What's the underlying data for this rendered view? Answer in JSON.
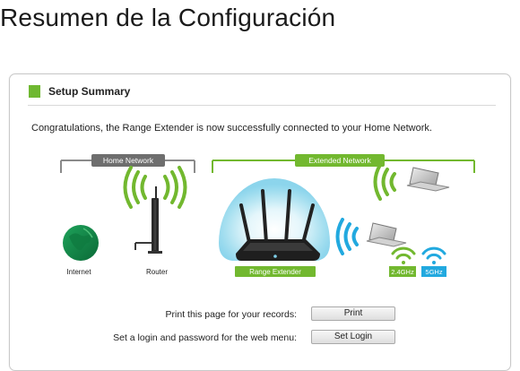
{
  "page": {
    "title": "Resumen de la Configuración"
  },
  "panel": {
    "header": "Setup Summary",
    "message": "Congratulations, the Range Extender is now successfully connected to your Home Network."
  },
  "diagram": {
    "home_network_label": "Home Network",
    "extended_network_label": "Extended Network",
    "internet_label": "Internet",
    "router_label": "Router",
    "range_extender_label": "Range Extender",
    "band_24_label": "2.4GHz",
    "band_5_label": "5GHz",
    "colors": {
      "gray_tag": "#6e6e6e",
      "green": "#72b82f",
      "blue": "#22a9df"
    }
  },
  "actions": {
    "print_label": "Print this page for your records:",
    "print_button": "Print",
    "login_label": "Set a login and password for the web menu:",
    "login_button": "Set Login"
  }
}
